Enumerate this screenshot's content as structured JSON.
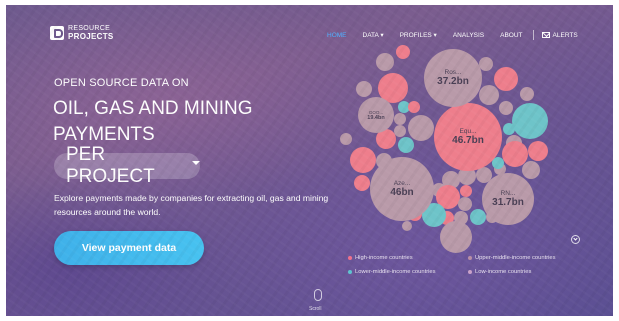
{
  "brand": {
    "line1": "RESOURCE",
    "line2": "PROJECTS"
  },
  "nav": {
    "home": "HOME",
    "data": "DATA",
    "profiles": "PROFILES",
    "analysis": "ANALYSIS",
    "about": "ABOUT",
    "alerts": "ALERTS"
  },
  "hero": {
    "kicker": "OPEN SOURCE DATA ON",
    "headline_line1": "OIL, GAS AND MINING",
    "headline_line2": "PAYMENTS",
    "selector": "PER PROJECT",
    "description": "Explore payments made by companies for extracting oil, gas and mining resources around the world.",
    "cta": "View payment data"
  },
  "bubbles": [
    {
      "label": "Equ...",
      "value": "46.7bn",
      "income": "high"
    },
    {
      "label": "Ros...",
      "value": "37.2bn",
      "income": "upper-middle"
    },
    {
      "label": "Aze...",
      "value": "46bn",
      "income": "upper-middle"
    },
    {
      "label": "RN...",
      "value": "31.7bn",
      "income": "upper-middle"
    },
    {
      "label": "GOO...",
      "value": "19.4bn",
      "income": "upper-middle"
    }
  ],
  "legend": [
    {
      "label": "High-income countries",
      "color": "#f0708a"
    },
    {
      "label": "Upper-middle-income countries",
      "color": "#b98fa5"
    },
    {
      "label": "Lower-middle-income countries",
      "color": "#5ec3cf"
    },
    {
      "label": "Low-income countries",
      "color": "#c8a0c8"
    }
  ],
  "colors": {
    "high": "#ee7e8c",
    "upper_middle": "#b99aa9",
    "lower_middle": "#6ec4c9",
    "accent": "#47b8ee"
  },
  "scroll": "Scroll"
}
